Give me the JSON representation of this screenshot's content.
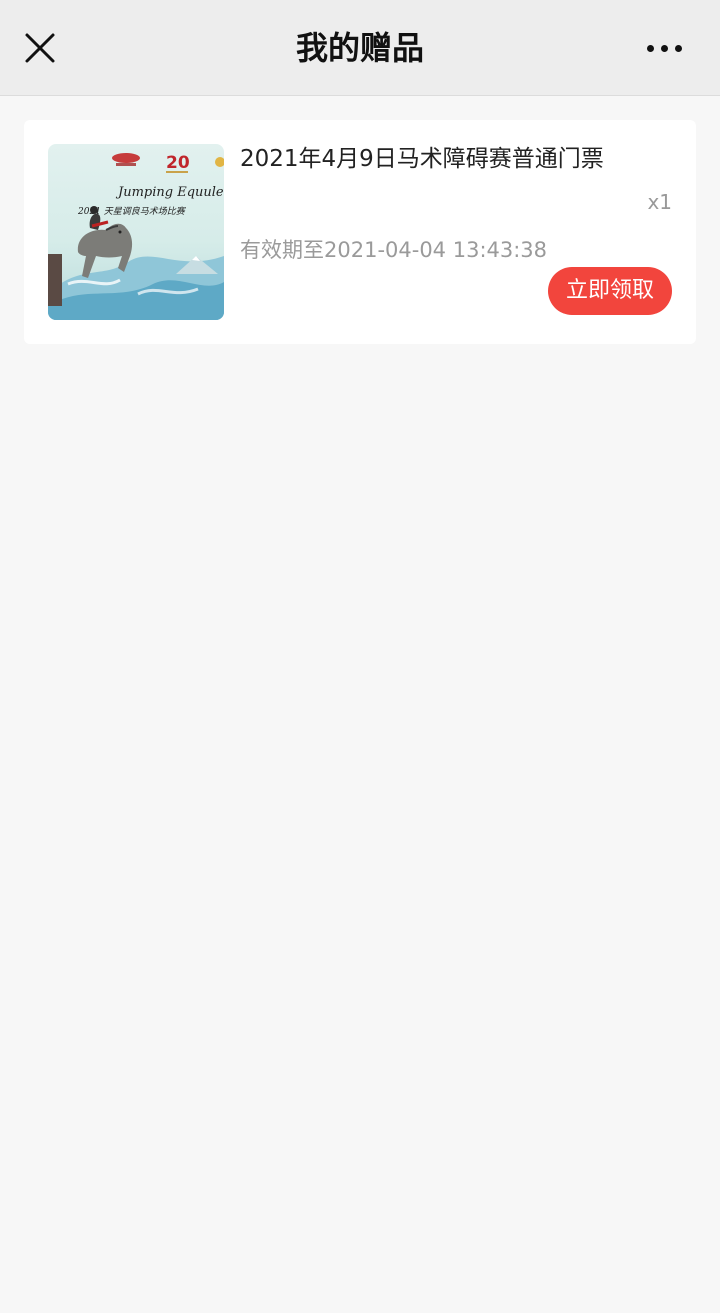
{
  "nav": {
    "title": "我的赠品",
    "close_icon": "close-icon",
    "more_icon": "more-dots-icon"
  },
  "gifts": [
    {
      "title": "2021年4月9日马术障碍赛普通门票",
      "quantity": "x1",
      "expiry": "有效期至2021-04-04 13:43:38",
      "claim_label": "立即领取",
      "thumbnail": {
        "headline": "Jumping Equuleus",
        "subline": "2021 天星调良马术场比赛",
        "badge": "20"
      }
    }
  ],
  "colors": {
    "nav_bg": "#ededed",
    "page_bg": "#f7f7f7",
    "card_bg": "#ffffff",
    "accent": "#f2453d",
    "muted_text": "#999999"
  }
}
